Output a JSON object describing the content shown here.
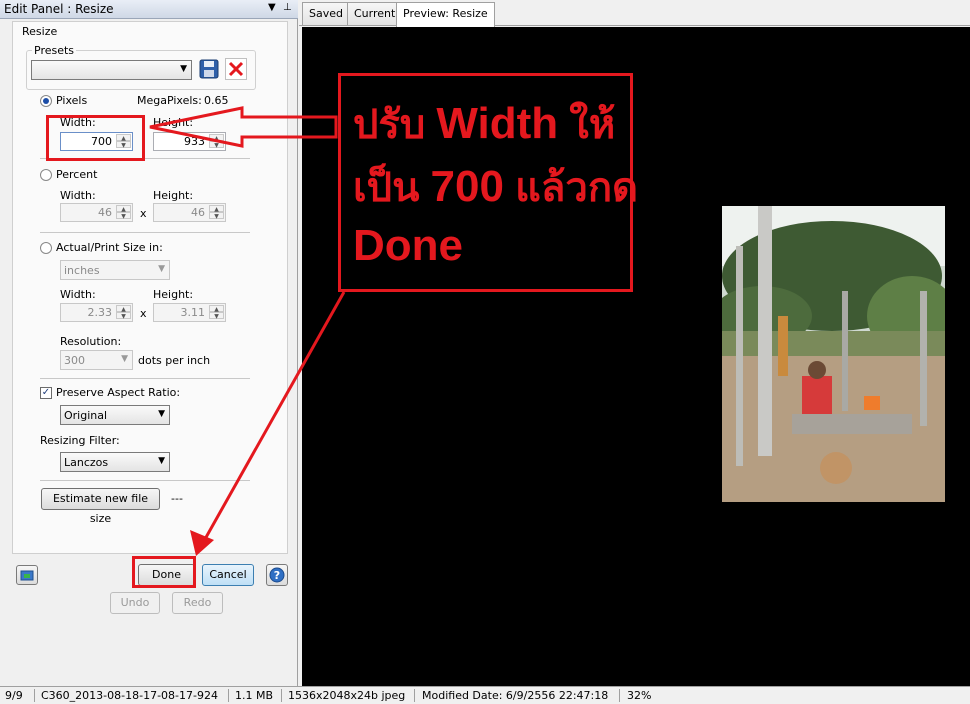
{
  "panel": {
    "title": "Edit Panel : Resize",
    "section_label": "Resize",
    "presets": {
      "label": "Presets",
      "value": ""
    },
    "pixels": {
      "label": "Pixels",
      "megapixels_label": "MegaPixels:",
      "megapixels_value": "0.65",
      "width_label": "Width:",
      "width_value": "700",
      "height_label": "Height:",
      "height_value": "933"
    },
    "percent": {
      "label": "Percent",
      "width_label": "Width:",
      "width_value": "46",
      "height_label": "Height:",
      "height_value": "46",
      "x": "x"
    },
    "print_size": {
      "label": "Actual/Print Size in:",
      "unit": "inches",
      "width_label": "Width:",
      "width_value": "2.33",
      "height_label": "Height:",
      "height_value": "3.11",
      "x": "x",
      "resolution_label": "Resolution:",
      "resolution_value": "300",
      "dpi_label": "dots per inch"
    },
    "preserve": {
      "label": "Preserve Aspect Ratio:",
      "checked": true,
      "value": "Original"
    },
    "filter": {
      "label": "Resizing Filter:",
      "value": "Lanczos"
    },
    "estimate": {
      "button": "Estimate new file size",
      "result": "---"
    },
    "buttons": {
      "done": "Done",
      "cancel": "Cancel",
      "undo": "Undo",
      "redo": "Redo"
    }
  },
  "tabs": [
    {
      "label": "Saved"
    },
    {
      "label": "Current"
    },
    {
      "label": "Preview: Resize",
      "active": true
    }
  ],
  "annotation": {
    "line1": "ปรับ",
    "line1_bold": "Width",
    "line1_tail": "ให้",
    "line2": "เป็น",
    "line2_bold": "700",
    "line2_tail": "แล้วกด",
    "line3": "Done",
    "color": "#e4181e"
  },
  "status": {
    "index": "9/9",
    "filename": "C360_2013-08-18-17-08-17-924",
    "filesize": "1.1 MB",
    "dimensions": "1536x2048x24b jpeg",
    "modified": "Modified Date: 6/9/2556 22:47:18",
    "zoom": "32%"
  },
  "colors": {
    "accent": "#e4181e",
    "preview_bg": "#000000",
    "selection": "#1d4ea7"
  }
}
